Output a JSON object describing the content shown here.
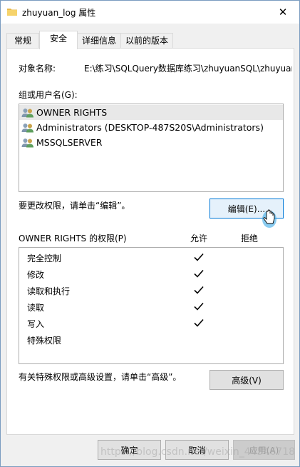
{
  "window": {
    "title": "zhuyuan_log 属性",
    "close_glyph": "✕"
  },
  "tabs": [
    {
      "label": "常规"
    },
    {
      "label": "安全"
    },
    {
      "label": "详细信息"
    },
    {
      "label": "以前的版本"
    }
  ],
  "active_tab": "安全",
  "security": {
    "object_label": "对象名称:",
    "object_path": "E:\\练习\\SQLQuery数据库练习\\zhuyuanSQL\\zhuyuan",
    "group_label": "组或用户名(G):",
    "users": [
      {
        "name": "OWNER RIGHTS",
        "icon": "users-icon",
        "selected": true
      },
      {
        "name": "Administrators (DESKTOP-487S20S\\Administrators)",
        "icon": "users-icon"
      },
      {
        "name": "MSSQLSERVER",
        "icon": "users-icon"
      }
    ],
    "edit_hint": "要更改权限，请单击“编辑”。",
    "edit_button": "编辑(E)...",
    "perm_title": "OWNER RIGHTS 的权限(P)",
    "allow_label": "允许",
    "deny_label": "拒绝",
    "permissions": [
      {
        "name": "完全控制",
        "allow": true,
        "deny": false
      },
      {
        "name": "修改",
        "allow": true,
        "deny": false
      },
      {
        "name": "读取和执行",
        "allow": true,
        "deny": false
      },
      {
        "name": "读取",
        "allow": true,
        "deny": false
      },
      {
        "name": "写入",
        "allow": true,
        "deny": false
      },
      {
        "name": "特殊权限",
        "allow": false,
        "deny": false
      }
    ],
    "advanced_hint": "有关特殊权限或高级设置，请单击“高级”。",
    "advanced_button": "高级(V)"
  },
  "footer": {
    "ok_button": "确定",
    "cancel_button": "取消",
    "apply_button": "应用(A)"
  },
  "watermark": "https://blog.csdn.net/weixin_44546718",
  "colors": {
    "selection": "#e8e8e8",
    "button_hover_border": "#0078d7",
    "window_bg": "#f0f0f0"
  }
}
